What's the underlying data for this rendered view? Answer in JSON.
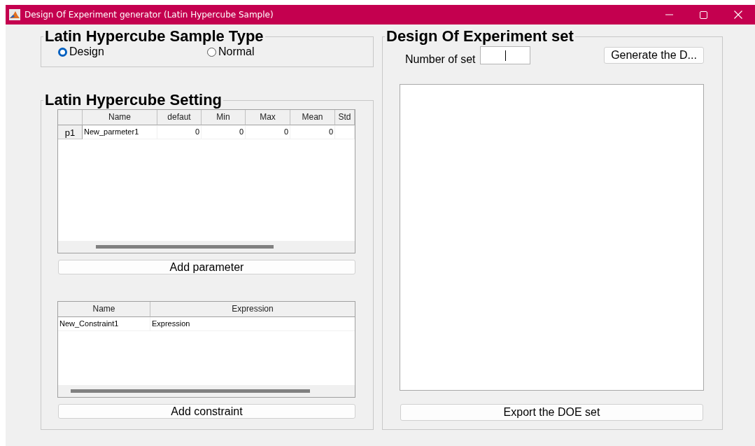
{
  "window": {
    "title": "Design Of Experiment generator (Latin Hypercube Sample)"
  },
  "sample_type": {
    "title": "Latin Hypercube Sample Type",
    "options": [
      {
        "label": "Design",
        "selected": true
      },
      {
        "label": "Normal",
        "selected": false
      }
    ]
  },
  "setting": {
    "title": "Latin Hypercube Setting",
    "parameter_table": {
      "columns": [
        "Name",
        "defaut",
        "Min",
        "Max",
        "Mean",
        "Std"
      ],
      "rows": [
        {
          "header": "p1",
          "cells": [
            "New_parmeter1",
            "0",
            "0",
            "0",
            "0"
          ]
        }
      ]
    },
    "add_parameter_button": "Add parameter",
    "constraint_table": {
      "columns": [
        "Name",
        "Expression"
      ],
      "rows": [
        {
          "cells": [
            "New_Constraint1",
            "Expression"
          ]
        }
      ]
    },
    "add_constraint_button": "Add constraint"
  },
  "doe_set": {
    "title": "Design Of Experiment set",
    "number_label": "Number of set",
    "generate_button": "Generate the D...",
    "export_button": "Export the DOE set"
  }
}
